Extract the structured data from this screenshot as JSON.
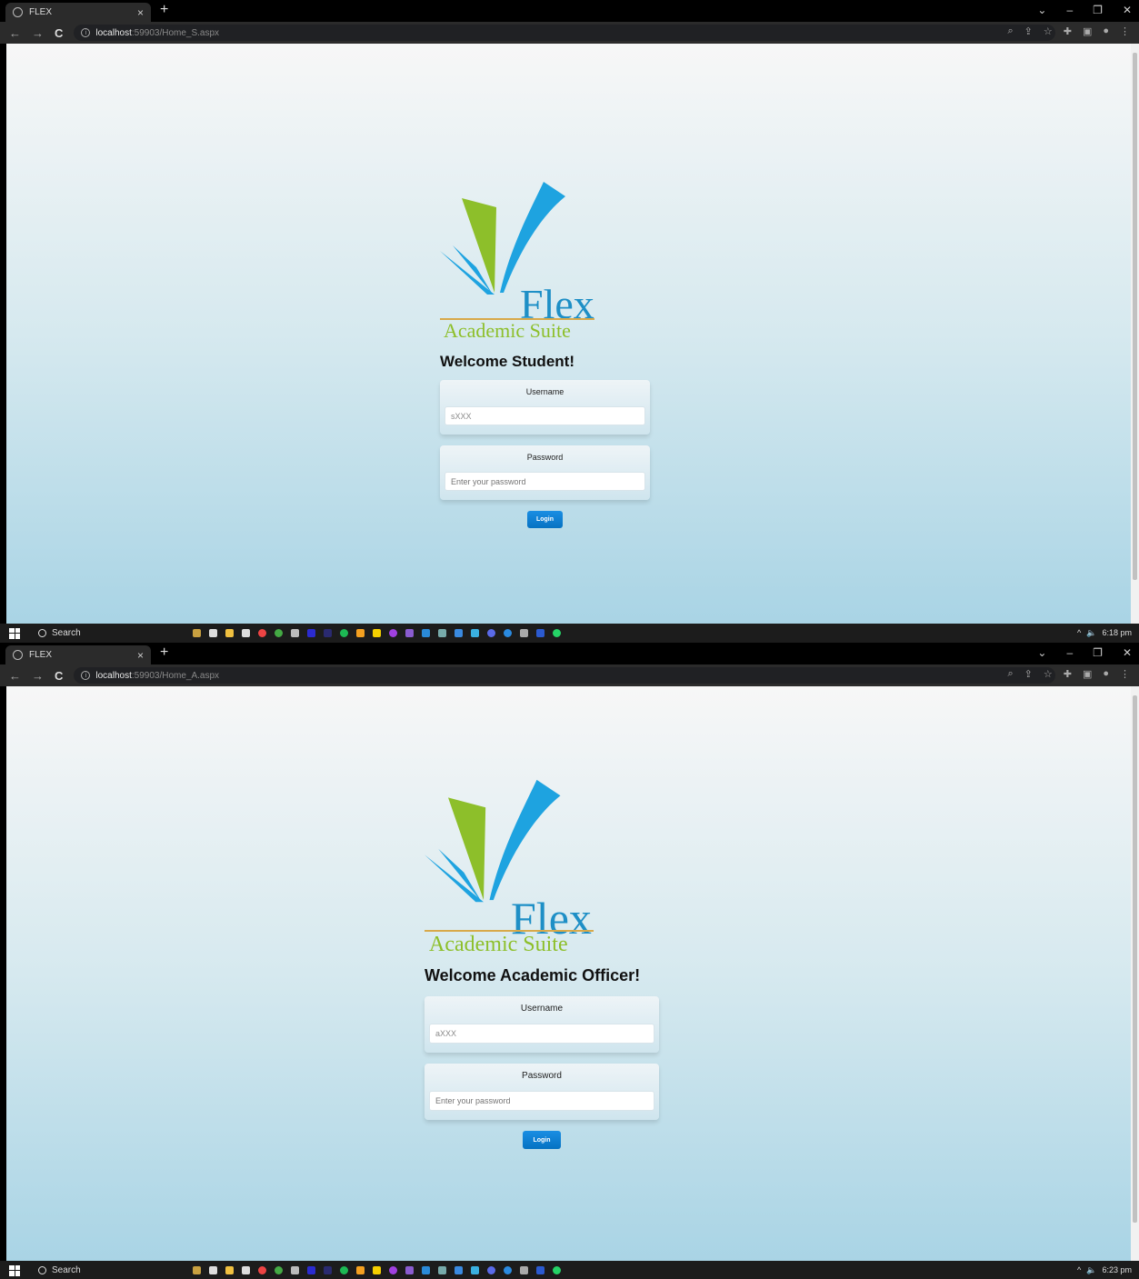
{
  "screens": [
    {
      "tab_title": "FLEX",
      "url_host": "localhost",
      "url_rest": ":59903/Home_S.aspx",
      "logo": {
        "flex_word": "Flex",
        "suite_word": "Academic Suite"
      },
      "welcome": "Welcome Student!",
      "username_label": "Username",
      "username_value": "sXXX",
      "password_label": "Password",
      "password_placeholder": "Enter your password",
      "login_label": "Login",
      "taskbar_search": "Search",
      "clock": "6:18 pm"
    },
    {
      "tab_title": "FLEX",
      "url_host": "localhost",
      "url_rest": ":59903/Home_A.aspx",
      "logo": {
        "flex_word": "Flex",
        "suite_word": "Academic Suite"
      },
      "welcome": "Welcome Academic Officer!",
      "username_label": "Username",
      "username_value": "aXXX",
      "password_label": "Password",
      "password_placeholder": "Enter your password",
      "login_label": "Login",
      "taskbar_search": "Search",
      "clock": "6:23 pm"
    }
  ],
  "colors": {
    "logo_blue": "#1e8fc6",
    "logo_green": "#8dbf2a",
    "button_blue": "#0672c2"
  }
}
